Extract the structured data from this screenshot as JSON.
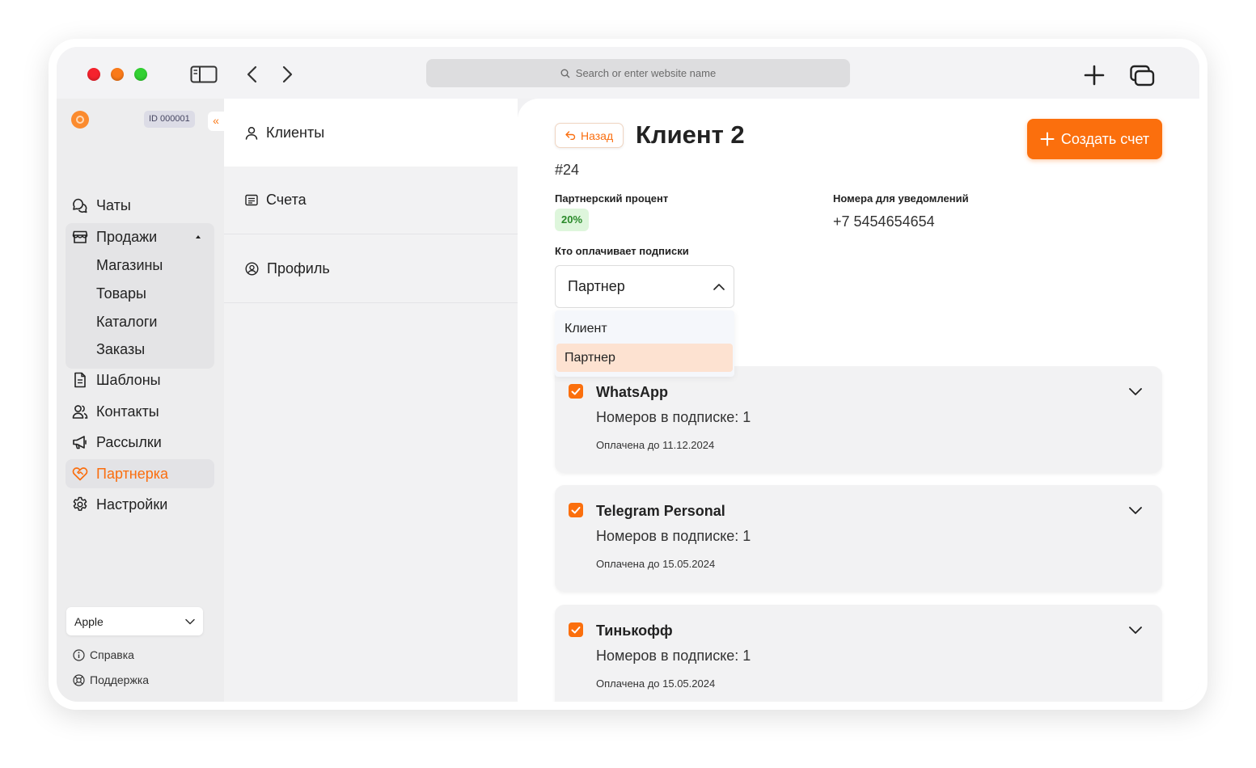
{
  "browser": {
    "url_placeholder": "Search or enter website name"
  },
  "sidebar": {
    "account_id": "ID 000001",
    "collapse_glyph": "«",
    "items": {
      "chats": "Чаты",
      "sales": "Продажи",
      "templates": "Шаблоны",
      "contacts": "Контакты",
      "mailings": "Рассылки",
      "partner": "Партнерка",
      "settings": "Настройки"
    },
    "sales_sub": {
      "shops": "Магазины",
      "products": "Товары",
      "catalogs": "Каталоги",
      "orders": "Заказы"
    },
    "shop_select": "Apple",
    "help": "Справка",
    "support": "Поддержка",
    "active_color": "#fa6e0f"
  },
  "midpanel": {
    "clients": "Клиенты",
    "invoices": "Счета",
    "profile": "Профиль"
  },
  "content": {
    "back_label": "Назад",
    "title": "Клиент 2",
    "client_id": "#24",
    "create_invoice_label": "Создать счет",
    "partner_percent_label": "Партнерский процент",
    "partner_percent_value": "20%",
    "notify_numbers_label": "Номера для уведомлений",
    "notify_numbers_value": "+7 5454654654",
    "payer_label": "Кто оплачивает подписки",
    "payer_selected": "Партнер",
    "payer_options": [
      "Клиент",
      "Партнер"
    ],
    "accent_color": "#fb6f0d",
    "subscriptions": [
      {
        "name": "WhatsApp",
        "count": "Номеров в подписке: 1",
        "paid": "Оплачена до 11.12.2024"
      },
      {
        "name": "Telegram Personal",
        "count": "Номеров в подписке: 1",
        "paid": "Оплачена до 15.05.2024"
      },
      {
        "name": "Тинькофф",
        "count": "Номеров в подписке: 1",
        "paid": "Оплачена до 15.05.2024"
      }
    ]
  }
}
